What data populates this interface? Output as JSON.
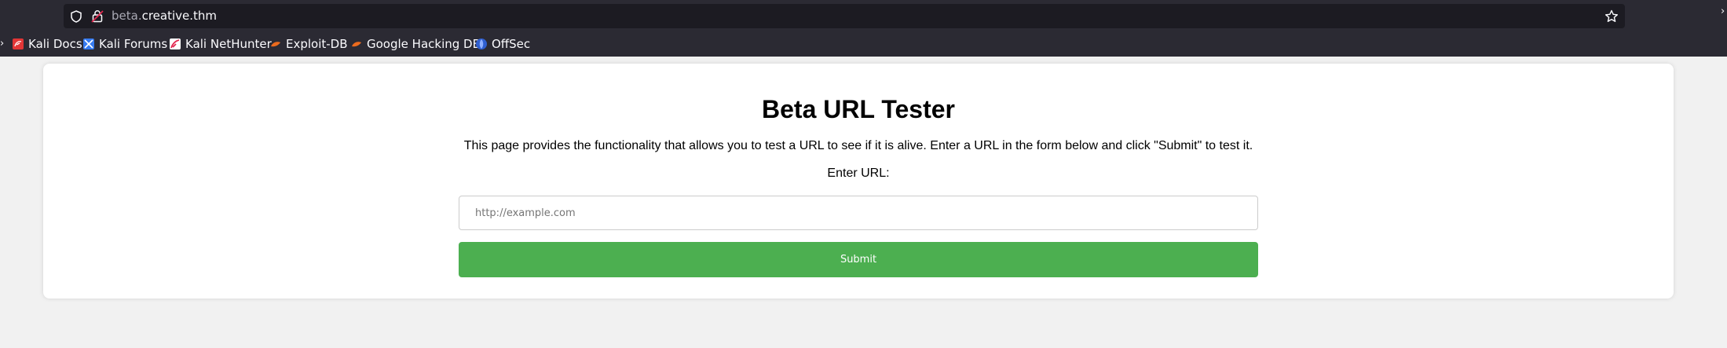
{
  "browser": {
    "url_subdomain": "beta.",
    "url_domain": "creative.thm",
    "bookmarks": [
      {
        "label": "Kali Docs",
        "icon": "kali-docs-icon"
      },
      {
        "label": "Kali Forums",
        "icon": "kali-forums-icon"
      },
      {
        "label": "Kali NetHunter",
        "icon": "kali-nethunter-icon"
      },
      {
        "label": "Exploit-DB",
        "icon": "exploit-db-icon"
      },
      {
        "label": "Google Hacking DB",
        "icon": "google-hacking-db-icon"
      },
      {
        "label": "OffSec",
        "icon": "offsec-icon"
      }
    ]
  },
  "page": {
    "title": "Beta URL Tester",
    "description": "This page provides the functionality that allows you to test a URL to see if it is alive. Enter a URL in the form below and click \"Submit\" to test it.",
    "url_label": "Enter URL:",
    "url_input": {
      "value": "",
      "placeholder": "http://example.com"
    },
    "submit_label": "Submit",
    "accent_color": "#4caf50"
  }
}
